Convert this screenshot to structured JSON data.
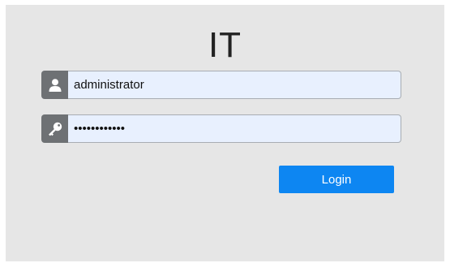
{
  "title": "IT",
  "username": {
    "icon": "user-icon",
    "value": "administrator"
  },
  "password": {
    "icon": "key-icon",
    "value": "••••••••••••"
  },
  "login_label": "Login"
}
